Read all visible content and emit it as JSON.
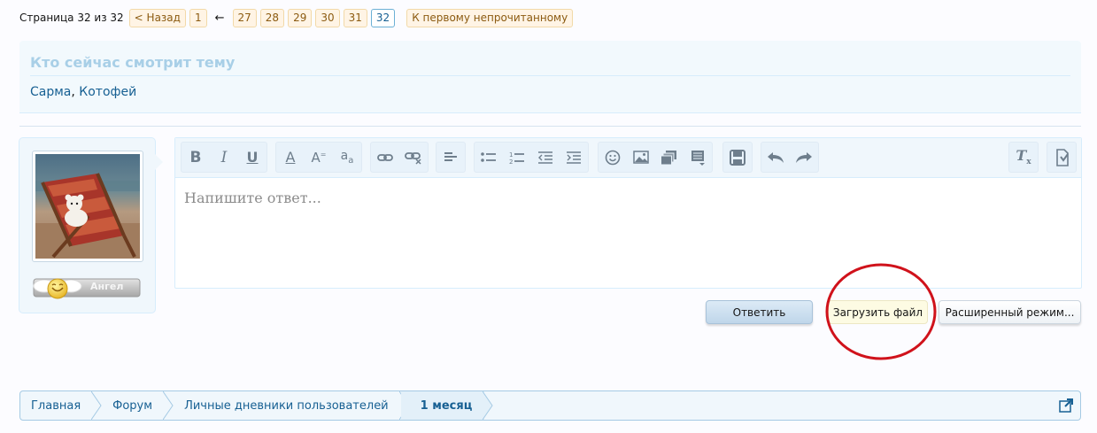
{
  "pagination": {
    "label": "Страница 32 из 32",
    "prev": "< Назад",
    "first_page": "1",
    "skip": "←",
    "pages": [
      "27",
      "28",
      "29",
      "30",
      "31"
    ],
    "current_page": "32",
    "first_unread": "К первому непрочитанному"
  },
  "viewers": {
    "title": "Кто сейчас смотрит тему",
    "user1": "Сарма",
    "comma": ",",
    "user2": "Котофей"
  },
  "user": {
    "rank": "Ангел"
  },
  "editor": {
    "placeholder": "Напишите ответ...",
    "toolbar_icons": [
      "bold-icon",
      "italic-icon",
      "underline-icon",
      "text-color-icon",
      "font-size-icon",
      "font-family-icon",
      "link-icon",
      "unlink-icon",
      "align-icon",
      "bulleted-list-icon",
      "numbered-list-icon",
      "outdent-icon",
      "indent-icon",
      "smiley-icon",
      "image-icon",
      "media-icon",
      "insert-icon",
      "save-draft-icon",
      "undo-icon",
      "redo-icon",
      "remove-format-icon",
      "toggle-bbcode-icon"
    ]
  },
  "actions": {
    "reply": "Ответить",
    "upload": "Загрузить файл",
    "advanced": "Расширенный режим..."
  },
  "breadcrumb": {
    "items": [
      "Главная",
      "Форум",
      "Личные дневники пользователей",
      "1 месяц"
    ]
  },
  "colors": {
    "link": "#176093",
    "page_accent": "#fff4e5",
    "annotation": "#d0121b"
  }
}
